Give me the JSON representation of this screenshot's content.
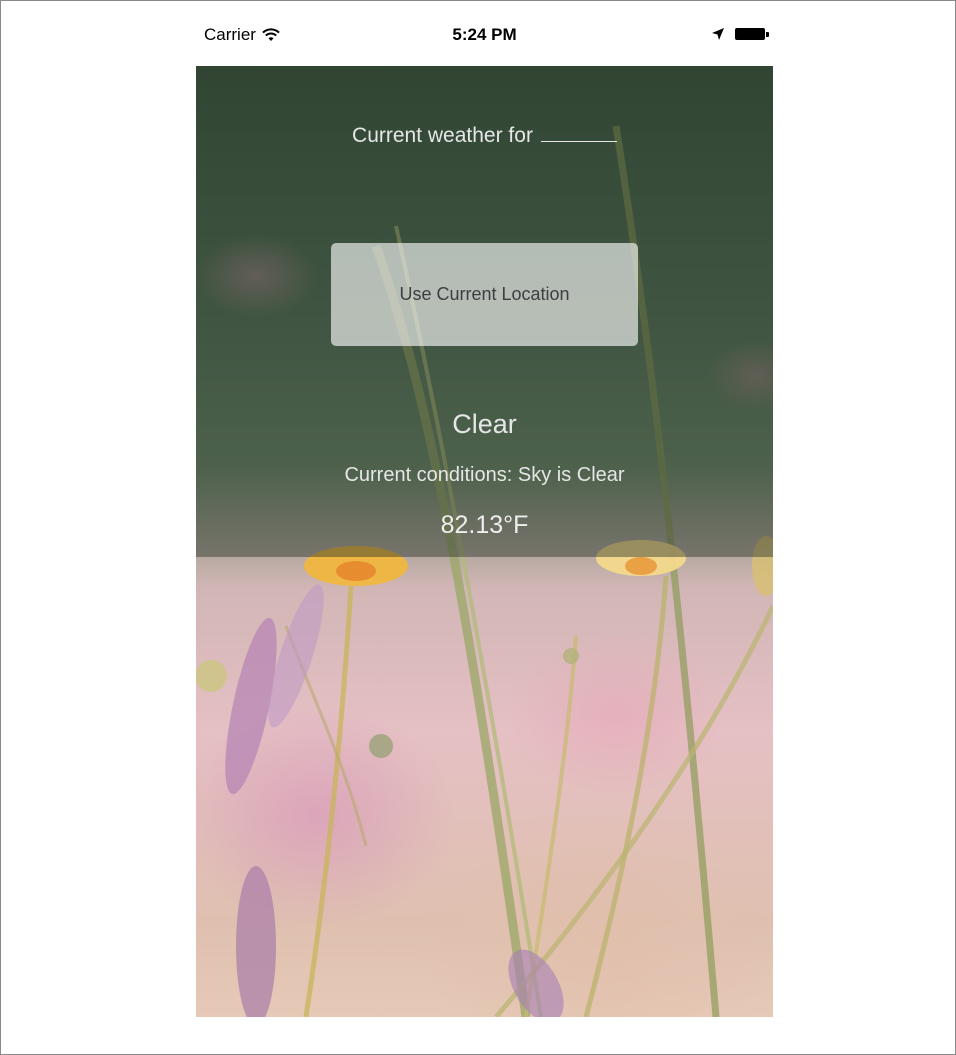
{
  "status_bar": {
    "carrier": "Carrier",
    "time": "5:24 PM",
    "icons": [
      "wifi-icon",
      "location-arrow-icon",
      "battery-icon"
    ]
  },
  "weather": {
    "heading": "Current weather for",
    "location_blank": "",
    "button_label": "Use Current Location",
    "condition": "Clear",
    "description": "Current conditions: Sky is Clear",
    "temperature": "82.13°F"
  },
  "colors": {
    "text": "#e6e6e6",
    "button_bg": "rgba(255,255,255,0.62)",
    "button_text": "#3e3e3e"
  }
}
